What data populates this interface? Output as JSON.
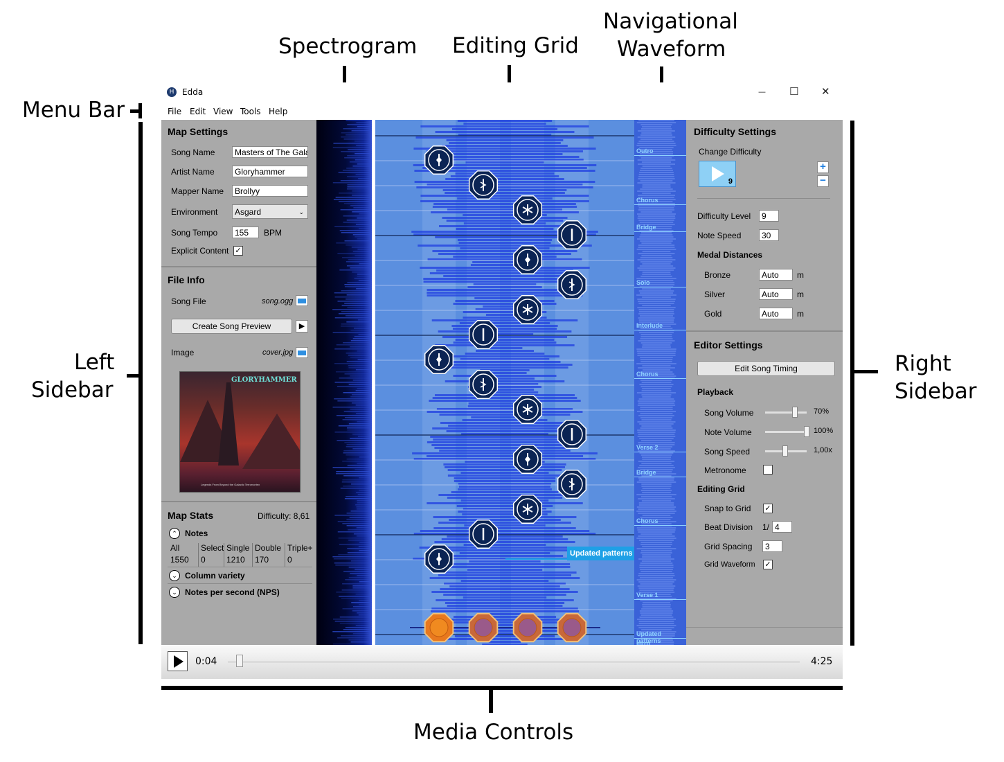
{
  "annotations": {
    "spectrogram": "Spectrogram",
    "editing_grid": "Editing Grid",
    "nav_waveform_1": "Navigational",
    "nav_waveform_2": "Waveform",
    "menu_bar": "Menu Bar",
    "left_sidebar_1": "Left",
    "left_sidebar_2": "Sidebar",
    "right_sidebar_1": "Right",
    "right_sidebar_2": "Sidebar",
    "media_controls": "Media Controls"
  },
  "window": {
    "title": "Edda",
    "logo": "H",
    "minimize": "—",
    "maximize": "☐",
    "close": "✕"
  },
  "menu": {
    "file": "File",
    "edit": "Edit",
    "view": "View",
    "tools": "Tools",
    "help": "Help"
  },
  "left": {
    "map_settings": {
      "title": "Map Settings",
      "song_name_label": "Song Name",
      "song_name": "Masters of The Gala",
      "artist_name_label": "Artist Name",
      "artist_name": "Gloryhammer",
      "mapper_name_label": "Mapper Name",
      "mapper_name": "Brollyy",
      "environment_label": "Environment",
      "environment": "Asgard",
      "tempo_label": "Song Tempo",
      "tempo": "155",
      "tempo_unit": "BPM",
      "explicit_label": "Explicit Content",
      "explicit": "✓"
    },
    "file_info": {
      "title": "File Info",
      "song_file_label": "Song File",
      "song_file": "song.ogg",
      "preview_button": "Create Song Preview",
      "image_label": "Image",
      "image_file": "cover.jpg",
      "cover_logo": "GLORYHAMMER",
      "cover_caption": "Legends From Beyond the Galactic Terrorvortex"
    },
    "map_stats": {
      "title": "Map Stats",
      "difficulty": "Difficulty: 8,61",
      "notes_label": "Notes",
      "headers": [
        "All",
        "Select",
        "Single",
        "Double",
        "Triple+"
      ],
      "values": [
        "1550",
        "0",
        "1210",
        "170",
        "0"
      ],
      "column_variety": "Column variety",
      "nps": "Notes per second (NPS)"
    }
  },
  "right": {
    "difficulty_settings": {
      "title": "Difficulty Settings",
      "change_label": "Change Difficulty",
      "difficulty_number": "9",
      "plus": "+",
      "minus": "−",
      "level_label": "Difficulty Level",
      "level": "9",
      "speed_label": "Note Speed",
      "speed": "30",
      "medal_title": "Medal Distances",
      "bronze_label": "Bronze",
      "bronze": "Auto",
      "silver_label": "Silver",
      "silver": "Auto",
      "gold_label": "Gold",
      "gold": "Auto",
      "unit": "m"
    },
    "editor_settings": {
      "title": "Editor Settings",
      "edit_timing_button": "Edit Song Timing",
      "playback_title": "Playback",
      "song_volume_label": "Song Volume",
      "song_volume": "70%",
      "note_volume_label": "Note Volume",
      "note_volume": "100%",
      "song_speed_label": "Song Speed",
      "song_speed": "1,00x",
      "metronome_label": "Metronome",
      "grid_title": "Editing Grid",
      "snap_label": "Snap to Grid",
      "snap": "✓",
      "beat_label": "Beat Division",
      "beat_prefix": "1/",
      "beat": "4",
      "spacing_label": "Grid Spacing",
      "spacing": "3",
      "waveform_label": "Grid Waveform",
      "waveform": "✓"
    }
  },
  "grid": {
    "popup": "Updated patterns"
  },
  "nav_sections": [
    "Outro",
    "Chorus",
    "Bridge",
    "Solo",
    "Interlude",
    "Chorus",
    "Verse 2",
    "Bridge",
    "Chorus",
    "Verse 1",
    "Updated patterns",
    "Intro"
  ],
  "media": {
    "current_time": "0:04",
    "total_time": "4:25",
    "progress": 0.015,
    "play": "▶"
  },
  "colors": {
    "grid_bg": "#5b8fdf",
    "waveform": "#1f3ee0",
    "note": "#0b2454",
    "drum": "#e8781e",
    "panel": "#a9a9a9"
  }
}
